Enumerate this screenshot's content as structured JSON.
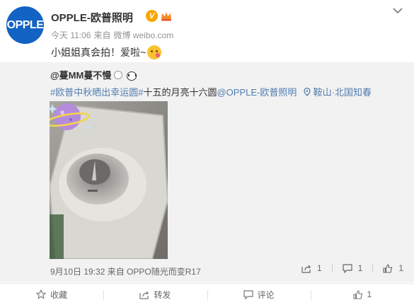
{
  "post": {
    "avatar_text": "OPPLE",
    "username": "OPPLE-欧普照明",
    "verified_badge": "V",
    "meta": {
      "time": "今天 11:06",
      "source_prefix": "来自",
      "source": "微博 weibo.com"
    },
    "text": "小姐姐真会拍！爱啦~"
  },
  "repost": {
    "username": "@蔓MM蔓不慢",
    "hashtag1": "#欧普中秋晒出幸运圆#",
    "text": "十五的月亮十六圆",
    "mention": "@OPPLE-欧普照明",
    "location": "鞍山·北国知春",
    "meta": "9月10日 19:32 来自 OPPO随光而变R17",
    "forward_count": "1",
    "comment_count": "1",
    "like_count": "1"
  },
  "toolbar": {
    "favorite": "收藏",
    "forward": "转发",
    "comment": "评论",
    "like_count": "1"
  },
  "colors": {
    "link": "#507daf",
    "brand": "#1363c4",
    "badge": "#f7a600"
  }
}
